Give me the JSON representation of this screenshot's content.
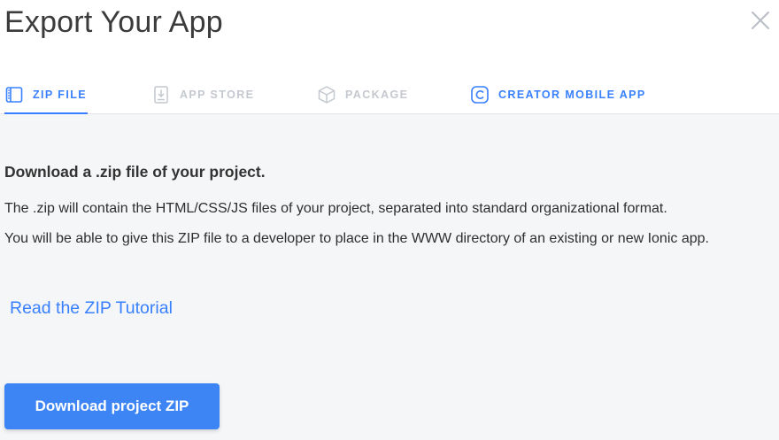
{
  "dialog": {
    "title": "Export Your App",
    "close_icon": "close-icon"
  },
  "tabs": [
    {
      "label": "ZIP FILE",
      "icon": "book-icon",
      "active": true
    },
    {
      "label": "APP STORE",
      "icon": "download-device-icon",
      "active": false
    },
    {
      "label": "PACKAGE",
      "icon": "cube-icon",
      "active": false
    },
    {
      "label": "CREATOR MOBILE APP",
      "icon": "creator-logo-icon",
      "active": false
    }
  ],
  "content": {
    "heading": "Download a .zip file of your project.",
    "paragraph1": "The .zip will contain the HTML/CSS/JS files of your project, separated into standard organizational format.",
    "paragraph2": "You will be able to give this ZIP file to a developer to place in the WWW directory of an existing or new Ionic app.",
    "tutorial_link": "Read the ZIP Tutorial",
    "download_button": "Download project ZIP"
  },
  "colors": {
    "accent": "#3880ff",
    "button": "#3d85f4",
    "inactive_tab": "#c4c8cf",
    "content_bg": "#f5f6f8"
  }
}
